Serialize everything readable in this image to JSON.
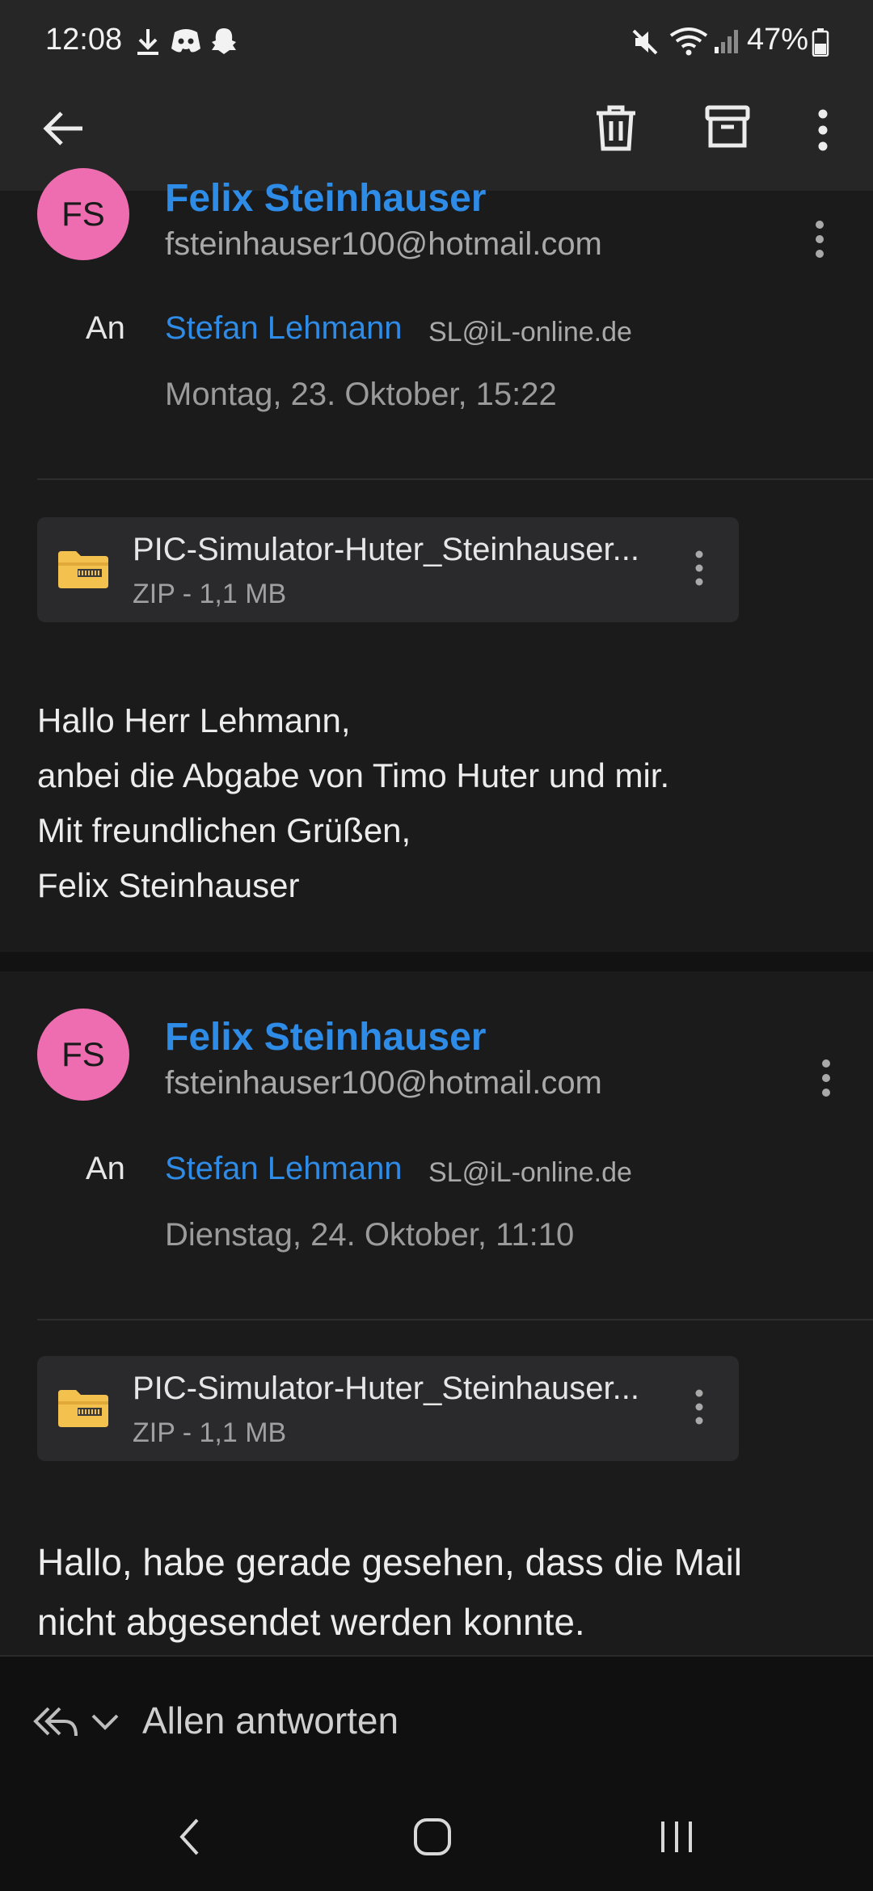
{
  "status": {
    "time": "12:08",
    "battery": "47%",
    "notification_icons": [
      "download-icon",
      "discord-icon",
      "snapchat-icon"
    ],
    "system_icons": [
      "mute-icon",
      "wifi-icon",
      "signal-icon",
      "battery-icon"
    ]
  },
  "toolbar": {
    "back": "back-arrow-icon",
    "delete": "trash-icon",
    "archive": "archive-icon",
    "more": "more-vert-icon"
  },
  "messages": [
    {
      "avatar_initials": "FS",
      "sender_name": "Felix Steinhauser",
      "sender_email": "fsteinhauser100@hotmail.com",
      "to_label": "An",
      "to_name": "Stefan Lehmann",
      "to_email": "SL@iL-online.de",
      "date": "Montag, 23. Oktober, 15:22",
      "attachment": {
        "name": "PIC-Simulator-Huter_Steinhauser...",
        "meta": "ZIP - 1,1 MB"
      },
      "body": [
        "Hallo Herr Lehmann,",
        "anbei die Abgabe von Timo Huter und mir.",
        "Mit freundlichen Grüßen,",
        "Felix Steinhauser"
      ]
    },
    {
      "avatar_initials": "FS",
      "sender_name": "Felix Steinhauser",
      "sender_email": "fsteinhauser100@hotmail.com",
      "to_label": "An",
      "to_name": "Stefan Lehmann",
      "to_email": "SL@iL-online.de",
      "date": "Dienstag, 24. Oktober, 11:10",
      "attachment": {
        "name": "PIC-Simulator-Huter_Steinhauser...",
        "meta": "ZIP - 1,1 MB"
      },
      "body": [
        "Hallo, habe gerade gesehen, dass die Mail",
        "nicht abgesendet werden konnte."
      ]
    }
  ],
  "reply": {
    "label": "Allen antworten"
  },
  "colors": {
    "accent": "#2e8be6",
    "avatar": "#ee6db0",
    "background": "#1b1b1c",
    "folder": "#f2c14e"
  }
}
